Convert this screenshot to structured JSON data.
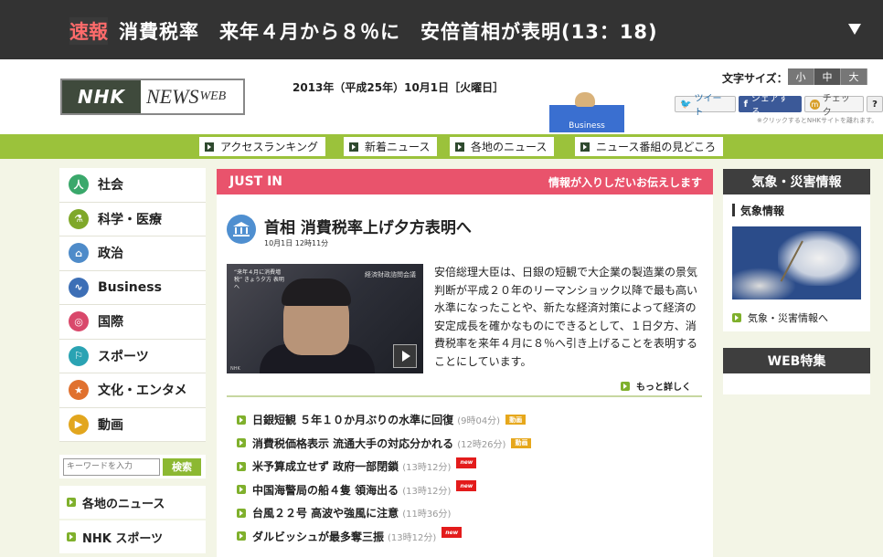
{
  "breaking": {
    "tag": "速報",
    "message": "消費税率　来年４月から８％に　安倍首相が表明(13：18)"
  },
  "header": {
    "logo_nhk": "NHK",
    "logo_news": "NEWS",
    "logo_web": "WEB",
    "date": "2013年（平成25年）10月1日［火曜日］",
    "font_size_label": "文字サイズ：",
    "font_sizes": [
      "小",
      "中",
      "大"
    ],
    "social": {
      "tweet": "ツイート",
      "fb_share": "シェアする",
      "mixi_check": "チェック",
      "help": "?"
    },
    "note": "※クリックするとNHKサイトを離れます。",
    "mascot_label": "Business"
  },
  "nav": {
    "items": [
      "アクセスランキング",
      "新着ニュース",
      "各地のニュース",
      "ニュース番組の見どころ"
    ]
  },
  "sidebar": {
    "categories": [
      {
        "label": "社会",
        "icon": "people-icon",
        "color": "#3aa86b",
        "glyph": "人"
      },
      {
        "label": "科学・医療",
        "icon": "flask-icon",
        "color": "#7fa82a",
        "glyph": "⚗"
      },
      {
        "label": "政治",
        "icon": "building-icon",
        "color": "#4e8bc9",
        "glyph": "⌂"
      },
      {
        "label": "Business",
        "icon": "chart-icon",
        "color": "#3d6fb6",
        "glyph": "∿"
      },
      {
        "label": "国際",
        "icon": "globe-icon",
        "color": "#d9486b",
        "glyph": "◎"
      },
      {
        "label": "スポーツ",
        "icon": "runner-icon",
        "color": "#2aa3b3",
        "glyph": "⚐"
      },
      {
        "label": "文化・エンタメ",
        "icon": "star-icon",
        "color": "#e0712f",
        "glyph": "★"
      },
      {
        "label": "動画",
        "icon": "play-icon",
        "color": "#e2a61e",
        "glyph": "▶"
      }
    ],
    "search_placeholder": "キーワードを入力",
    "search_button": "検索",
    "links": [
      "各地のニュース",
      "NHK スポーツ"
    ]
  },
  "justin": {
    "label": "JUST IN",
    "tagline": "情報が入りしだいお伝えします"
  },
  "article": {
    "headline": "首相 消費税率上げ夕方表明へ",
    "timestamp": "10月1日 12時11分",
    "video_caption": "“来年４月に消費増税” きょう夕方 表明へ",
    "video_sign": "経済財政諮問会議",
    "video_logo": "NHK",
    "body": "安倍総理大臣は、日銀の短観で大企業の製造業の景気判断が平成２０年のリーマンショック以降で最も高い水準になったことや、新たな経済対策によって経済の安定成長を確かなものにできるとして、１日夕方、消費税率を来年４月に８％へ引き上げることを表明することにしています。",
    "more": "もっと詳しく"
  },
  "news": [
    {
      "title": "日銀短観 ５年１０か月ぶりの水準に回復",
      "time": "(9時04分)",
      "badge": "動画",
      "badge_type": "video"
    },
    {
      "title": "消費税価格表示 流通大手の対応分かれる",
      "time": "(12時26分)",
      "badge": "動画",
      "badge_type": "video"
    },
    {
      "title": "米予算成立せず 政府一部閉鎖",
      "time": "(13時12分)",
      "badge": "new",
      "badge_type": "new"
    },
    {
      "title": "中国海警局の船４隻 領海出る",
      "time": "(13時12分)",
      "badge": "new",
      "badge_type": "new"
    },
    {
      "title": "台風２２号 高波や強風に注意",
      "time": "(11時36分)",
      "badge": "",
      "badge_type": ""
    },
    {
      "title": "ダルビッシュが最多奪三振",
      "time": "(13時12分)",
      "badge": "new",
      "badge_type": "new"
    }
  ],
  "right": {
    "weather_title": "気象・災害情報",
    "weather_sub": "気象情報",
    "weather_link": "気象・災害情報へ",
    "web_title": "WEB特集"
  }
}
